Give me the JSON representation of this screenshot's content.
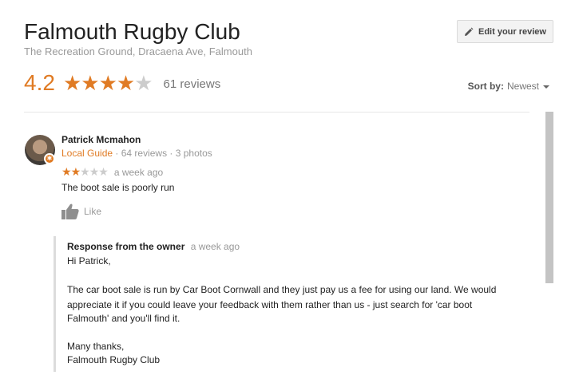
{
  "place": {
    "name": "Falmouth Rugby Club",
    "address": "The Recreation Ground, Dracaena Ave, Falmouth",
    "rating": "4.2",
    "rating_value": 4.2,
    "stars_filled": 4,
    "stars_total": 5,
    "review_count": "61 reviews"
  },
  "edit_button": {
    "label": "Edit your review"
  },
  "sort": {
    "label": "Sort by:",
    "value": "Newest"
  },
  "review": {
    "reviewer_name": "Patrick Mcmahon",
    "local_guide": "Local Guide",
    "meta": " · 64 reviews · 3 photos",
    "stars_filled": 2,
    "stars_total": 5,
    "time": "a week ago",
    "text": "The boot sale is poorly run",
    "like_label": "Like"
  },
  "response": {
    "owner_label": "Response from the owner",
    "time": "a week ago",
    "greeting": "Hi Patrick,",
    "para1_line1": "The car boot sale is run by Car Boot Cornwall and they just pay us a fee for using our land. We would",
    "para1_line2": "appreciate it if you could leave your feedback with them rather than us - just search for 'car boot",
    "para1_line3": "Falmouth' and you'll find it.",
    "closing": "Many thanks,",
    "signature": "Falmouth Rugby Club"
  },
  "colors": {
    "accent": "#e07b24",
    "star_empty": "#cccccc",
    "muted": "#999999"
  }
}
